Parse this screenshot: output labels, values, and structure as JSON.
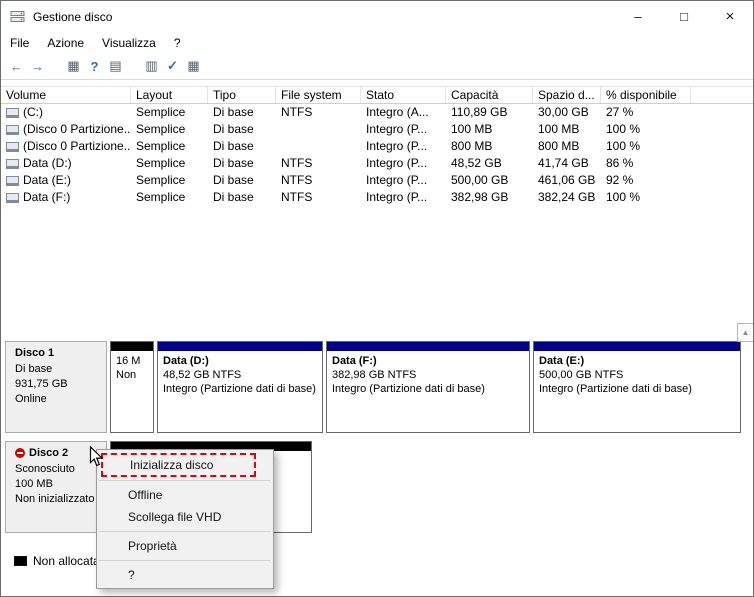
{
  "titlebar": {
    "title": "Gestione disco",
    "minimize_glyph": "–",
    "maximize_glyph": "□",
    "close_glyph": "×"
  },
  "menubar": {
    "items": [
      "File",
      "Azione",
      "Visualizza",
      "?"
    ]
  },
  "toolbar": {
    "icons": [
      {
        "name": "back-icon",
        "glyph": "←",
        "style": "blue",
        "gap": false
      },
      {
        "name": "forward-icon",
        "glyph": "→",
        "style": "blue",
        "gap": false
      },
      {
        "name": "show-console-tree-icon",
        "glyph": "▦",
        "style": "plain",
        "gap": true
      },
      {
        "name": "help-icon",
        "glyph": "?",
        "style": "blue",
        "gap": false
      },
      {
        "name": "export-list-icon",
        "glyph": "▤",
        "style": "plain",
        "gap": false
      },
      {
        "name": "properties-icon",
        "glyph": "▥",
        "style": "plain",
        "gap": true
      },
      {
        "name": "check-icon",
        "glyph": "✓",
        "style": "blue",
        "gap": false
      },
      {
        "name": "fields-icon",
        "glyph": "▦",
        "style": "plain",
        "gap": false
      }
    ]
  },
  "volume_list": {
    "columns": [
      "Volume",
      "Layout",
      "Tipo",
      "File system",
      "Stato",
      "Capacità",
      "Spazio d...",
      "% disponibile"
    ],
    "rows": [
      [
        "(C:)",
        "Semplice",
        "Di base",
        "NTFS",
        "Integro (A...",
        "110,89 GB",
        "30,00 GB",
        "27 %"
      ],
      [
        "(Disco 0 Partizione...",
        "Semplice",
        "Di base",
        "",
        "Integro (P...",
        "100 MB",
        "100 MB",
        "100 %"
      ],
      [
        "(Disco 0 Partizione...",
        "Semplice",
        "Di base",
        "",
        "Integro (P...",
        "800 MB",
        "800 MB",
        "100 %"
      ],
      [
        "Data (D:)",
        "Semplice",
        "Di base",
        "NTFS",
        "Integro (P...",
        "48,52 GB",
        "41,74 GB",
        "86 %"
      ],
      [
        "Data (E:)",
        "Semplice",
        "Di base",
        "NTFS",
        "Integro (P...",
        "500,00 GB",
        "461,06 GB",
        "92 %"
      ],
      [
        "Data (F:)",
        "Semplice",
        "Di base",
        "NTFS",
        "Integro (P...",
        "382,98 GB",
        "382,24 GB",
        "100 %"
      ]
    ]
  },
  "disks": [
    {
      "name": "Disco 1",
      "type": "Di base",
      "size": "931,75 GB",
      "status": "Online",
      "partitions": [
        {
          "line1": "16 M",
          "line2": "Non",
          "line3": "",
          "strip": "#000000"
        },
        {
          "line1": "Data (D:)",
          "line2": "48,52 GB NTFS",
          "line3": "Integro (Partizione dati di base)",
          "strip": "#00008b"
        },
        {
          "line1": "Data (F:)",
          "line2": "382,98 GB NTFS",
          "line3": "Integro (Partizione dati di base)",
          "strip": "#00008b"
        },
        {
          "line1": "Data (E:)",
          "line2": "500,00 GB NTFS",
          "line3": "Integro (Partizione dati di base)",
          "strip": "#00008b"
        }
      ]
    },
    {
      "name": "Disco 2",
      "type": "Sconosciuto",
      "size": "100 MB",
      "status": "Non inizializzato",
      "partitions": [
        {
          "line1": "",
          "line2": "",
          "line3": "",
          "strip": "#000000"
        }
      ]
    }
  ],
  "legend": {
    "unallocated_label": "Non allocata",
    "unallocated_color": "#000000"
  },
  "context_menu": {
    "items": [
      "Inizializza disco",
      "Offline",
      "Scollega file VHD",
      "Proprietà",
      "?"
    ],
    "highlight_border_color": "#e60000"
  }
}
